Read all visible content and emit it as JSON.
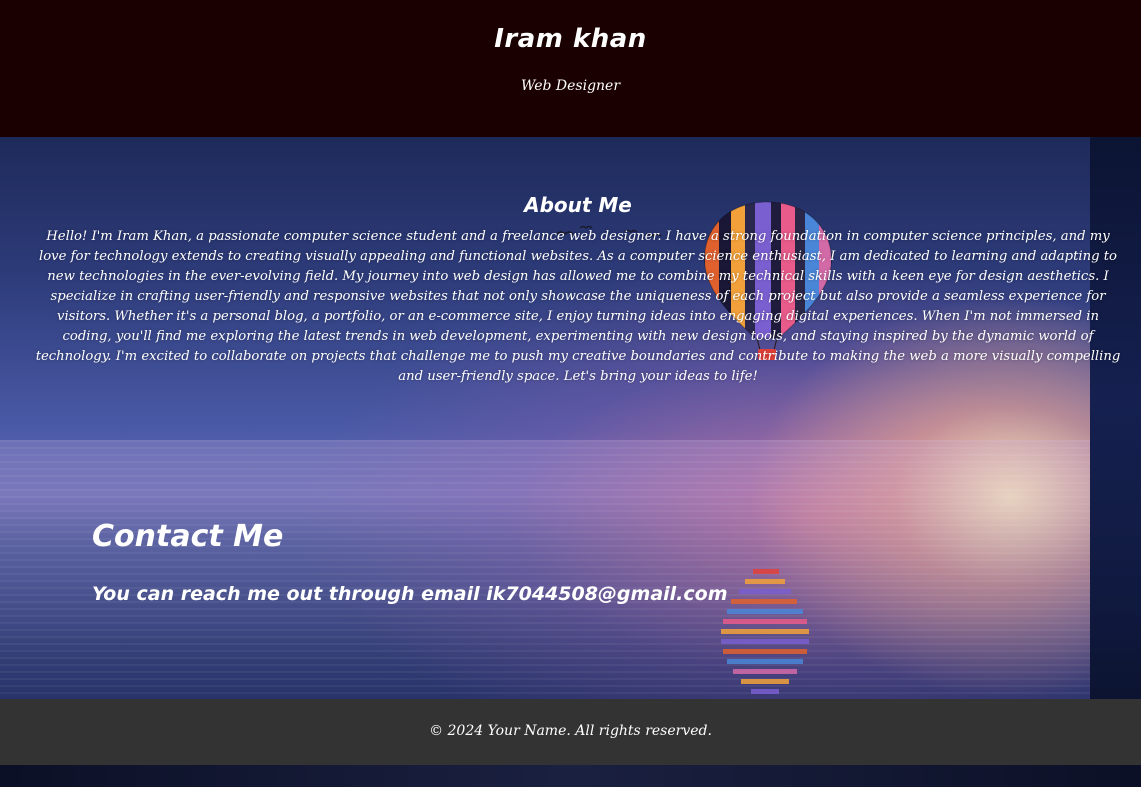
{
  "header": {
    "title": "Iram khan",
    "subtitle": "Web Designer",
    "background_color": "#1a0000"
  },
  "about": {
    "heading": "About Me",
    "text": "Hello! I'm Iram Khan, a passionate computer science student and a freelance web designer. I have a strong foundation in computer science principles, and my love for technology extends to creating visually appealing and functional websites. As a computer science enthusiast, I am dedicated to learning and adapting to new technologies in the ever-evolving field. My journey into web design has allowed me to combine my technical skills with a keen eye for design aesthetics. I specialize in crafting user-friendly and responsive websites that not only showcase the uniqueness of each project but also provide a seamless experience for visitors. Whether it's a personal blog, a portfolio, or an e-commerce site, I enjoy turning ideas into engaging digital experiences. When I'm not immersed in coding, you'll find me exploring the latest trends in web development, experimenting with new design tools, and staying inspired by the dynamic world of technology. I'm excited to collaborate on projects that challenge me to push my creative boundaries and contribute to making the web a more visually compelling and user-friendly space. Let's bring your ideas to life!"
  },
  "contact": {
    "heading": "Contact Me",
    "text_prefix": "You can reach me out through email ",
    "email": "ik7044508@gmail.com"
  },
  "footer": {
    "text": "© 2024 Your Name. All rights reserved.",
    "background_color": "#333333"
  },
  "background": {
    "icon": "hot-air-balloon-over-sea-at-sunset",
    "colors": {
      "sky_top": "#1e2a5a",
      "horizon_glow": "#ffecbe",
      "sea": "#2d3a72"
    }
  }
}
